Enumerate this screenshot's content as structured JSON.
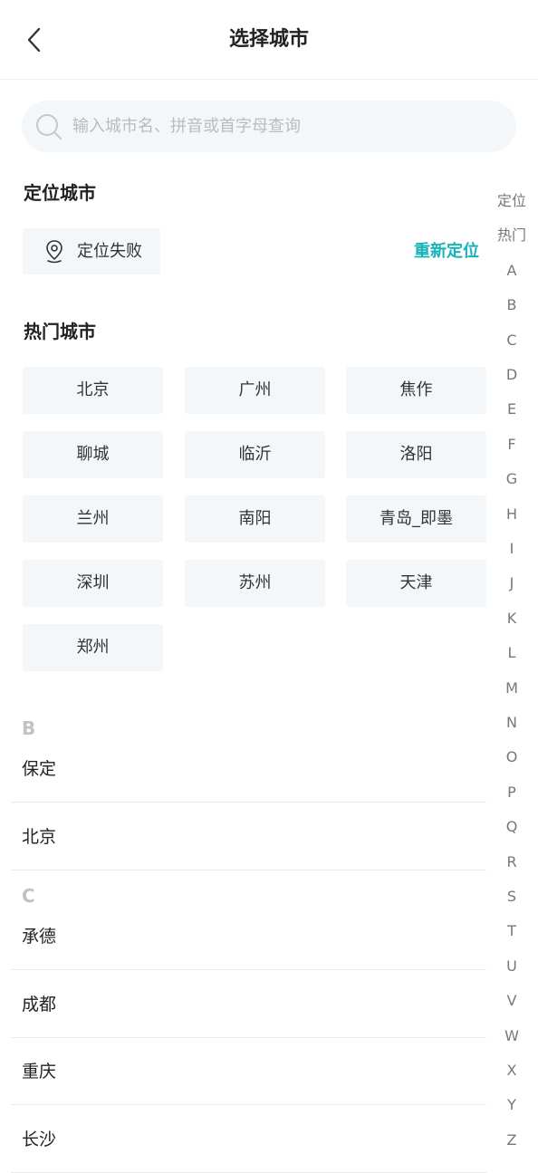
{
  "header": {
    "title": "选择城市"
  },
  "search": {
    "placeholder": "输入城市名、拼音或首字母查询",
    "value": ""
  },
  "location": {
    "section_title": "定位城市",
    "status": "定位失败",
    "relocate_label": "重新定位"
  },
  "hot": {
    "section_title": "热门城市",
    "cities": [
      "北京",
      "广州",
      "焦作",
      "聊城",
      "临沂",
      "洛阳",
      "兰州",
      "南阳",
      "青岛_即墨",
      "深圳",
      "苏州",
      "天津",
      "郑州"
    ]
  },
  "groups": [
    {
      "letter": "B",
      "cities": [
        "保定",
        "北京"
      ]
    },
    {
      "letter": "C",
      "cities": [
        "承德",
        "成都",
        "重庆",
        "长沙"
      ]
    }
  ],
  "index": [
    "定位",
    "热门",
    "A",
    "B",
    "C",
    "D",
    "E",
    "F",
    "G",
    "H",
    "I",
    "J",
    "K",
    "L",
    "M",
    "N",
    "O",
    "P",
    "Q",
    "R",
    "S",
    "T",
    "U",
    "V",
    "W",
    "X",
    "Y",
    "Z"
  ],
  "colors": {
    "accent": "#16b3b8",
    "chip_background": "#f3f7fa",
    "letter_gray": "#c2c2c2"
  }
}
